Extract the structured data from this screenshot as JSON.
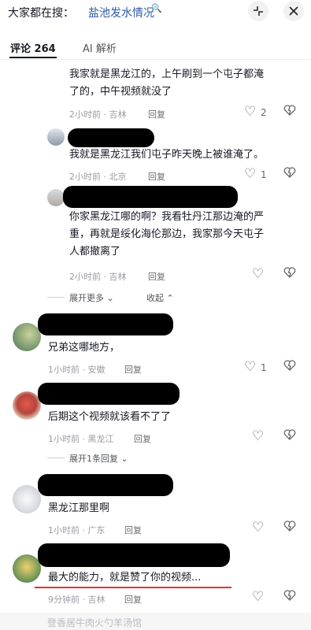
{
  "header": {
    "search_prefix": "大家都在搜：",
    "search_term": "盐池发水情况",
    "search_glyph": "🔍",
    "collapse_symbol": "⌖",
    "close_symbol": "✕"
  },
  "tabs": [
    {
      "label": "评论 264",
      "active": true
    },
    {
      "label": "AI 解析",
      "active": false
    }
  ],
  "comments": [
    {
      "text_line1": "我家就是黑龙江的，上午刷到一个屯子都淹",
      "text_line2": "了的，中午视频就没了",
      "time": "2小时前 · 吉林",
      "reply": "回复",
      "likes": "2"
    },
    {
      "text": "我就是黑龙江我们屯子昨天晚上被谁淹了。",
      "time": "2小时前 · 北京",
      "reply": "回复",
      "likes": "1"
    },
    {
      "text_line1": "你家黑龙江哪的啊？我看牡丹江那边淹的严",
      "text_line2": "重，再就是绥化海伦那边，我家那今天屯子",
      "text_line3": "人都撤离了",
      "time": "2小时前 · 吉林",
      "reply": "回复",
      "likes": ""
    },
    {
      "text": "兄弟这哪地方，",
      "time": "1小时前 · 安徽",
      "reply": "回复",
      "likes": "1"
    },
    {
      "text": "后期这个视频就该看不了了",
      "time": "1小时前 · 黑龙江",
      "reply": "回复",
      "likes": ""
    },
    {
      "text": "黑龙江那里啊",
      "time": "1小时前 · 广东",
      "reply": "回复",
      "likes": ""
    },
    {
      "text": "最大的能力，就是赞了你的视频...",
      "time": "9分钟前 · 吉林",
      "reply": "回复",
      "likes": ""
    }
  ],
  "expand_more": "展开更多 ⌄",
  "collapse": "收起 ⌃",
  "expand_one": "展开1条回复 ⌄",
  "bottom_partial": "登香居牛肉火勺羊汤馆",
  "icons": {
    "like": "♡",
    "dislike": "♡"
  }
}
